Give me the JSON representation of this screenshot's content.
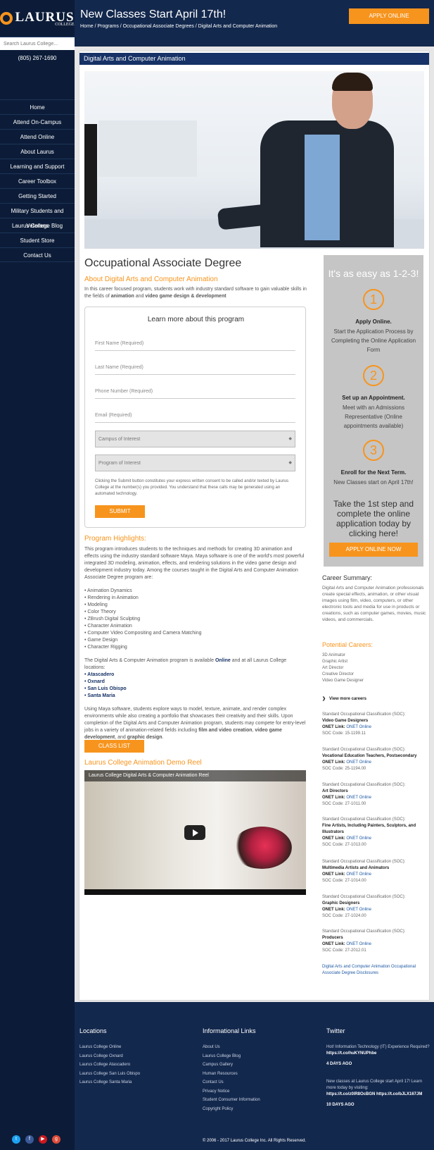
{
  "site": {
    "logo_text": "LAURUS",
    "logo_sub": "COLLEGE",
    "search_placeholder": "Search Laurus College...",
    "phone": "(805) 267-1690"
  },
  "nav": [
    "Home",
    "Attend On-Campus",
    "Attend Online",
    "About Laurus",
    "Learning and Support",
    "Career Toolbox",
    "Getting Started",
    "Military Students and Veterans",
    "Laurus College Blog",
    "Student Store",
    "Contact Us"
  ],
  "header": {
    "title": "New Classes Start April 17th!",
    "breadcrumb": "Home / Programs / Occupational Associate Degrees / Digital Arts and Computer Animation",
    "apply_label": "APPLY ONLINE"
  },
  "page": {
    "section_title": "Digital Arts and Computer Animation",
    "degree_title": "Occupational Associate Degree",
    "about_title": "About Digital Arts and Computer Animation",
    "about_text": "In this career focused program, students work with industry standard software to gain valuable skills in the fields of",
    "about_bold1": "animation",
    "about_and": "and",
    "about_bold2": "video game design & development"
  },
  "form": {
    "heading": "Learn more about this program",
    "first_name": "First Name (Required)",
    "last_name": "Last Name (Required)",
    "phone": "Phone Number (Required)",
    "email": "Email (Required)",
    "campus": "Campus of Interest",
    "program": "Program of Interest",
    "disclaimer": "Clicking the Submit button constitutes your express written consent to be called and/or texted by Laurus College at the number(s) you provided. You understand that these calls may be generated using an automated technology.",
    "submit_label": "SUBMIT"
  },
  "highlights": {
    "title": "Program Highlights:",
    "intro": "This program introduces students to the techniques and methods for creating 3D animation and effects using the industry standard software Maya. Maya software is one of the world's most powerful integrated 3D modeling, animation, effects, and rendering solutions in the video game design and development industry today. Among the courses taught in the Digital Arts and Computer Animation Associate Degree program are:",
    "courses": [
      "• Animation Dynamics",
      "• Rendering in Animation",
      "• Modeling",
      "• Color Theory",
      "• ZBrush Digital Sculpting",
      "• Character Animation",
      "• Computer Video Compositing and Camera Matching",
      "• Game Design",
      "• Character Rigging"
    ],
    "availability_a": "The Digital Arts & Computer Animation program is available",
    "availability_online": "Online",
    "availability_b": "and at all Laurus College locations:",
    "locations": [
      "• Atascadero",
      "• Oxnard",
      "• San Luis Obispo",
      "• Santa Maria"
    ],
    "outro": "Using Maya software, students explore ways to model, texture, animate, and render complex environments while also creating a portfolio that showcases their creativity and their skills. Upon completion of the Digital Arts and Computer Animation program, students may compete for entry-level jobs in a variety of animation-related fields including",
    "outro_b1": "film and video creation",
    "outro_b2": "video game development",
    "outro_b3": "graphic design",
    "class_list_label": "CLASS LIST",
    "demo_title": "Laurus College Animation Demo Reel",
    "video_title": "Laurus College Digital Arts & Computer Animation Reel"
  },
  "steps": {
    "title": "It's as easy as 1-2-3!",
    "items": [
      {
        "num": "1",
        "head": "Apply Online.",
        "text": "Start the Application Process by Completing the Online Application Form"
      },
      {
        "num": "2",
        "head": "Set up an Appointment.",
        "text": "Meet with an Admissions Representative (Online appointments available)"
      },
      {
        "num": "3",
        "head": "Enroll for the Next Term.",
        "text": "New Classes start on April 17th!"
      }
    ],
    "tagline": "Take the 1st step and complete the online application today by clicking here!",
    "cta_label": "APPLY ONLINE NOW"
  },
  "career": {
    "summary_title": "Career Summary:",
    "summary_text": "Digital Arts and Computer Animation professionals create special effects, animation, or other visual images using film, video, computers, or other electronic tools and media for use in products or creations, such as computer games, movies, music videos, and commercials.",
    "potential_title": "Potential Careers:",
    "careers": [
      "3D Animator",
      "Graphic Artist",
      "Art Director",
      "Creative Director",
      "Video Game Designer"
    ],
    "view_more": "View more careers",
    "soc_label": "Standard Occupational Classification (SOC):",
    "onet_label": "ONET Link:",
    "onet_value": "ONET Online",
    "soc": [
      {
        "title": "Video Game Designers",
        "code": "SOC Code: 15-1199.11"
      },
      {
        "title": "Vocational Education Teachers, Postsecondary",
        "code": "SOC Code: 25-1194.00"
      },
      {
        "title": "Art Directors",
        "code": "SOC Code: 27-1011.00"
      },
      {
        "title": "Fine Artists, Including Painters, Sculptors, and Illustrators",
        "code": "SOC Code: 27-1013.00"
      },
      {
        "title": "Multimedia Artists and Animators",
        "code": "SOC Code: 27-1014.00"
      },
      {
        "title": "Graphic Designers",
        "code": "SOC Code: 27-1024.00"
      },
      {
        "title": "Producers",
        "code": "SOC Code: 27-2012.01"
      }
    ],
    "disclosure": "Digital Arts and Computer Animation Occupational Associate Degree Disclosures"
  },
  "footer": {
    "locations_title": "Locations",
    "locations": [
      "Laurus College Online",
      "Laurus College Oxnard",
      "Laurus College Atascadero",
      "Laurus College San Luis Obispo",
      "Laurus College Santa Maria"
    ],
    "links_title": "Informational Links",
    "links": [
      "About Us",
      "Laurus College Blog",
      "Campus Gallery",
      "Human Resources",
      "Contact Us",
      "Privacy Notice",
      "Student Consumer Information",
      "Copyright Policy"
    ],
    "twitter_title": "Twitter",
    "tweets": [
      {
        "text": "Hot! Information Technology (IT) Experience Required?",
        "link": "https://t.co/huKYNUPhbe",
        "ago": "4 DAYS AGO"
      },
      {
        "text": "New classes at Laurus College start April 17! Learn more today by visiting:",
        "link": "https://t.co/z0lR8OcBGN https://t.co/bJLX167JM",
        "ago": "10 DAYS AGO"
      }
    ],
    "copyright": "© 2006 - 2017 Laurus College Inc. All Rights Reserved."
  },
  "colors": {
    "navy": "#13284d",
    "accent": "#f7941d",
    "link": "#1f59a3"
  }
}
